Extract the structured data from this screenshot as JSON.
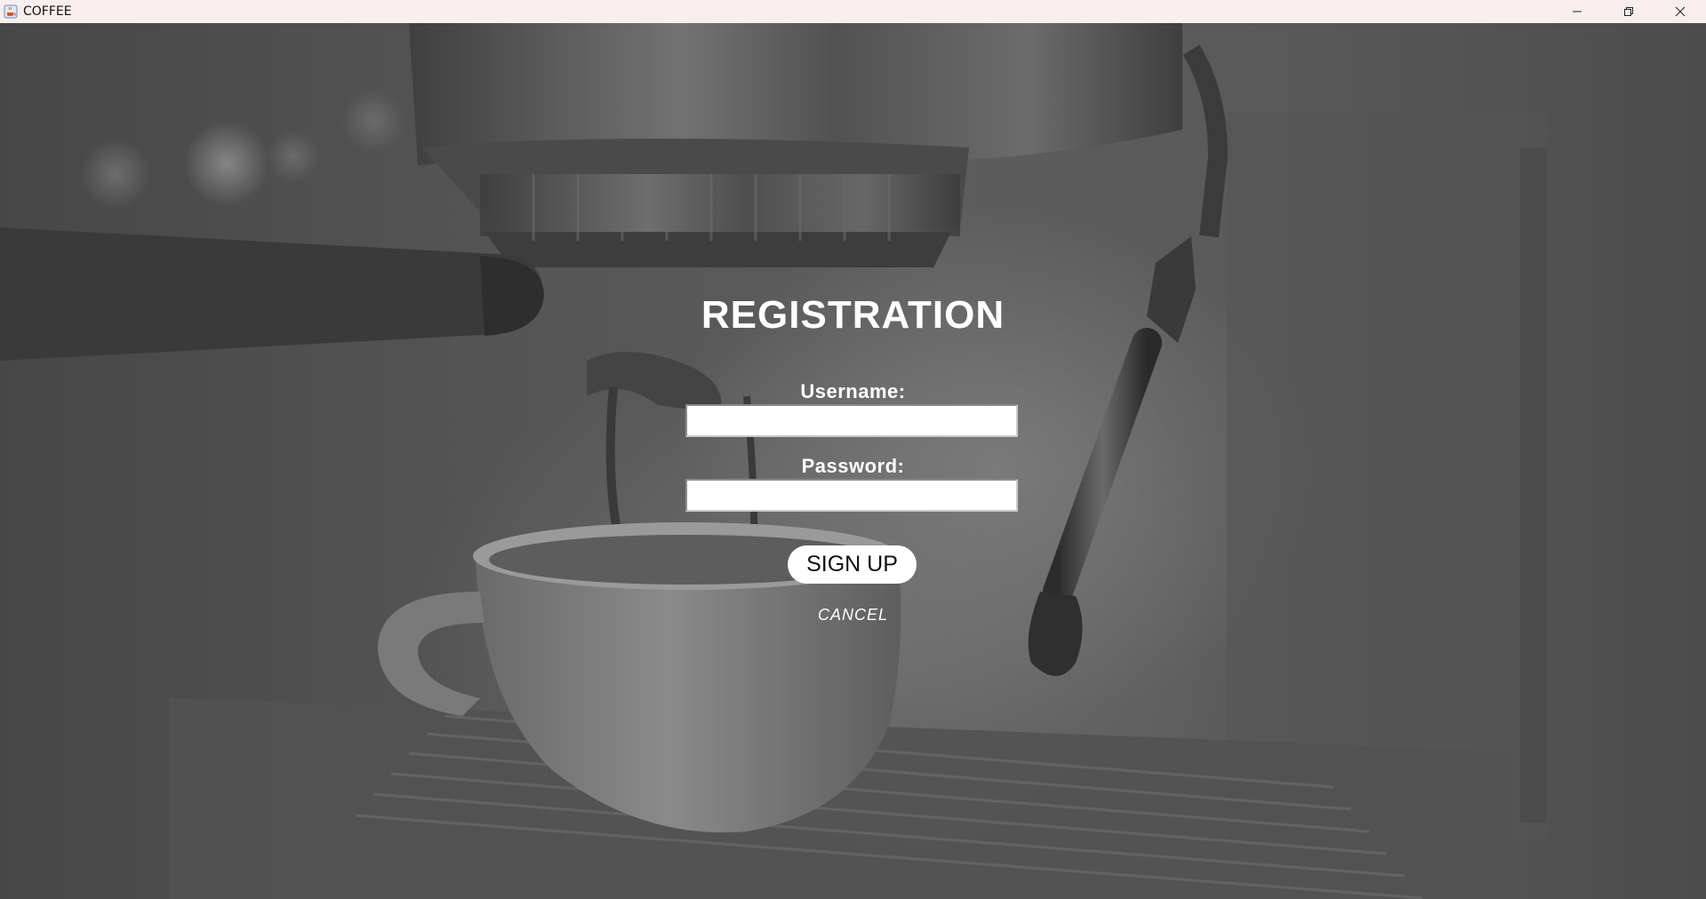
{
  "window": {
    "title": "COFFEE",
    "icons": {
      "app": "java-cup-icon",
      "minimize": "minimize-icon",
      "restore": "restore-icon",
      "close": "close-icon"
    }
  },
  "form": {
    "title": "REGISTRATION",
    "username_label": "Username:",
    "username_value": "",
    "password_label": "Password:",
    "password_value": "",
    "signup_label": "SIGN UP",
    "cancel_label": "CANCEL"
  },
  "colors": {
    "titlebar": "#f9eeee",
    "background": "#5a5a5a",
    "text": "#ffffff",
    "button_bg": "#ffffff"
  }
}
